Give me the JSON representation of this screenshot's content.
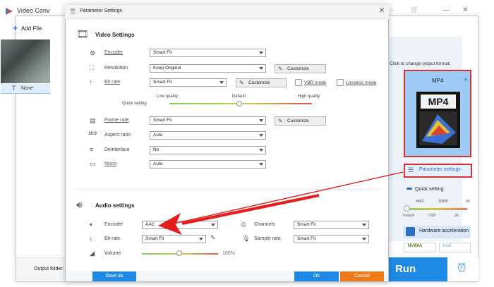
{
  "background_window": {
    "title": "Video Conv",
    "add_files_label": "Add File",
    "subtitle_value": "None",
    "output_folder_label": "Output folder:",
    "run_label": "Run",
    "format_hint": "Click to change output format:",
    "format_name": "MP4",
    "format_image_text": "MP4",
    "parameter_settings_label": "Parameter settings",
    "quick_setting_label": "Quick setting",
    "quick_ticks_top": [
      "480P",
      "1080P",
      "4K"
    ],
    "quick_ticks_bottom": [
      "Default",
      "720P",
      "2K"
    ],
    "hardware_acceleration_label": "Hardware acceleration",
    "nvidia_label": "NVIDIA",
    "intel_label": "Intel"
  },
  "dialog": {
    "title": "Parameter Settings",
    "video_settings": {
      "title": "Video Settings",
      "encoder_label": "Encoder",
      "encoder_value": "Smart Fit",
      "resolution_label": "Resolution",
      "resolution_value": "Keep Original",
      "customize_label": "Customize",
      "bitrate_label": "Bit rate",
      "bitrate_value": "Smart Fit",
      "vbr_label": "VBR mode",
      "lossless_label": "Lossless mode",
      "low_quality": "Low quality",
      "default_quality": "Default",
      "high_quality": "High quality",
      "quick_setting": "Quick setting",
      "framerate_label": "Frame rate",
      "framerate_value": "Smart Fit",
      "aspect_label": "Aspect ratio",
      "aspect_value": "Auto",
      "deinterlace_label": "Deinterlace",
      "deinterlace_value": "No",
      "norm_label": "Norm",
      "norm_value": "Auto"
    },
    "audio_settings": {
      "title": "Audio settings",
      "encoder_label": "Encoder",
      "encoder_value": "AAC",
      "channels_label": "Channels",
      "channels_value": "Smart Fit",
      "bitrate_label": "Bit rate",
      "bitrate_value": "Smart Fit",
      "samplerate_label": "Sample rate",
      "samplerate_value": "Smart Fit",
      "volume_label": "Volume",
      "volume_value": "100%"
    },
    "save_as_label": "Save as",
    "ok_label": "Ok",
    "cancel_label": "Cancel"
  },
  "colors": {
    "accent": "#1e8ae6",
    "highlight": "#d93030",
    "cancel": "#f07a1a"
  }
}
